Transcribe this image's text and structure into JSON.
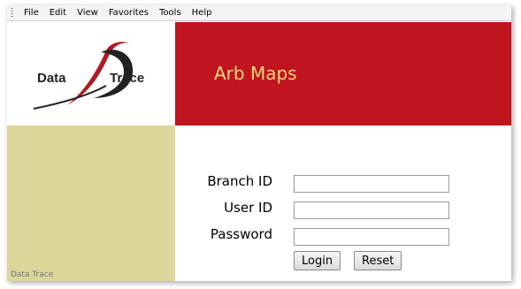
{
  "menu": {
    "items": [
      "File",
      "Edit",
      "View",
      "Favorites",
      "Tools",
      "Help"
    ]
  },
  "logo": {
    "word_left": "Data",
    "word_right": "Trace",
    "letter": "D"
  },
  "banner": {
    "title": "Arb Maps",
    "color": "#c0141e",
    "title_color": "#f5d77c"
  },
  "sidebar": {
    "color": "#dbd69a",
    "footer_text": "Data Trace"
  },
  "login_form": {
    "branch_label": "Branch  ID",
    "branch_value": "",
    "user_label": "User ID",
    "user_value": "",
    "password_label": "Password",
    "password_value": "",
    "login_button": "Login",
    "reset_button": "Reset"
  }
}
